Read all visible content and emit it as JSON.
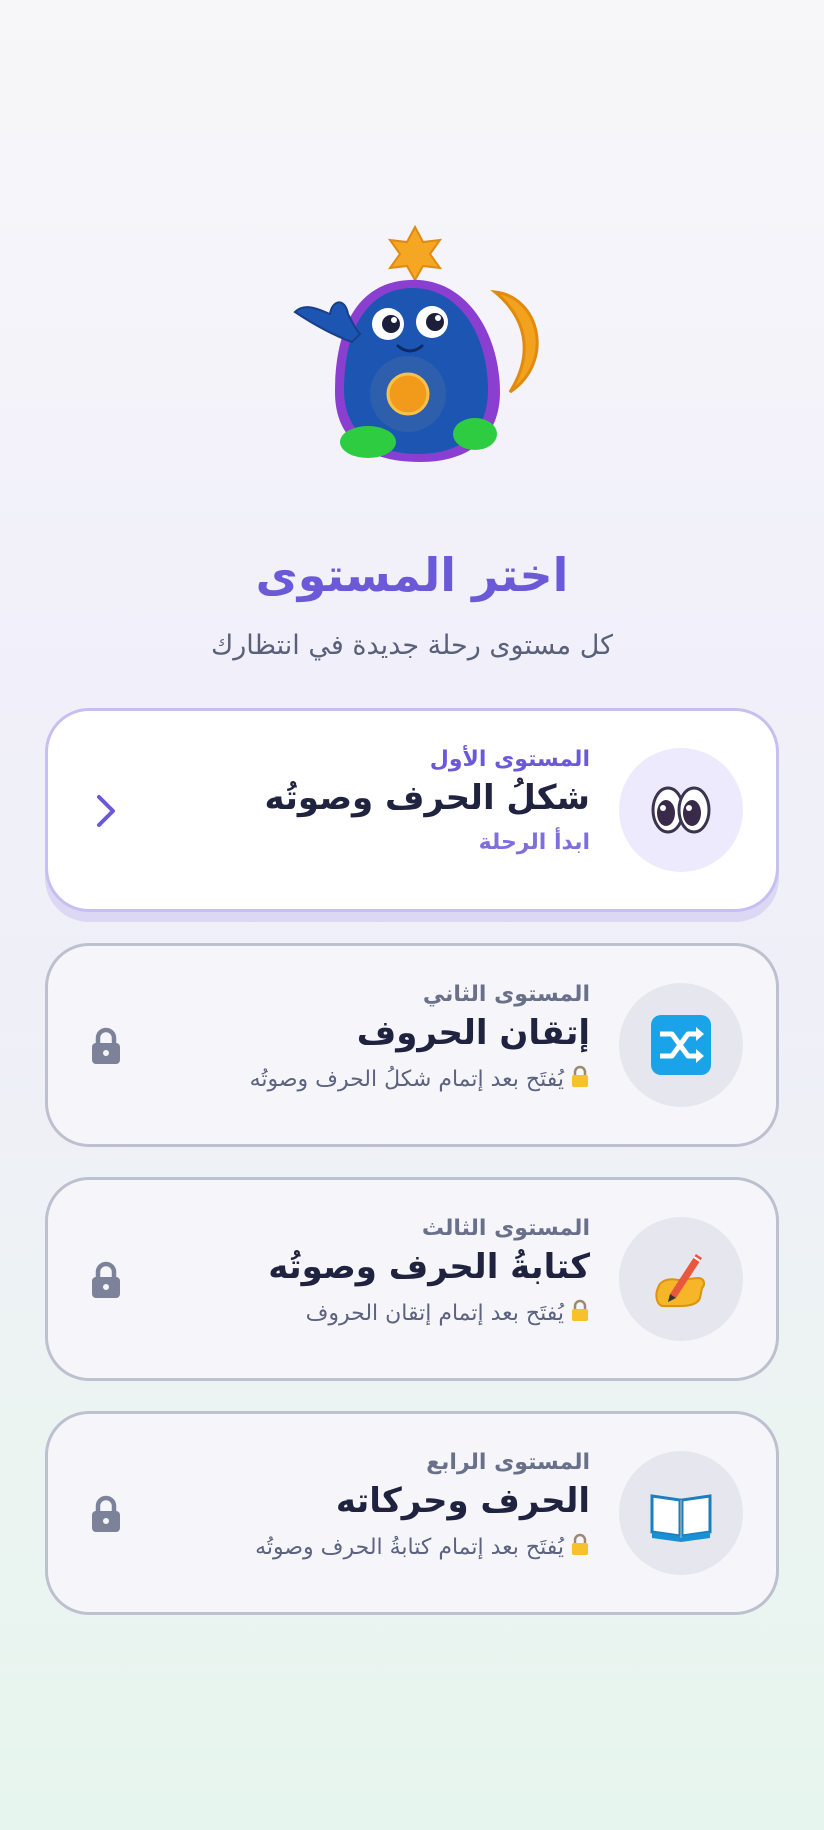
{
  "header": {
    "title": "اختر المستوى",
    "subtitle": "كل مستوى رحلة جديدة في انتظارك"
  },
  "levels": [
    {
      "label": "المستوى الأول",
      "name": "شكلُ الحرف وصوتُه",
      "status": "ابدأ الرحلة",
      "icon": "eyes-icon",
      "locked": false
    },
    {
      "label": "المستوى الثاني",
      "name": "إتقان الحروف",
      "status": "يُفتَح بعد إتمام شكلُ الحرف وصوتُه",
      "icon": "shuffle-icon",
      "locked": true
    },
    {
      "label": "المستوى الثالث",
      "name": "كتابةُ الحرف وصوتُه",
      "status": "يُفتَح بعد إتمام إتقان الحروف",
      "icon": "writing-hand-icon",
      "locked": true
    },
    {
      "label": "المستوى الرابع",
      "name": "الحرف وحركاته",
      "status": "يُفتَح بعد إتمام كتابةُ الحرف وصوتُه",
      "icon": "open-book-icon",
      "locked": true
    }
  ],
  "colors": {
    "accent": "#6a5ad8",
    "text": "#1f2340",
    "muted": "#5b6380",
    "lock": "#7b8299"
  }
}
